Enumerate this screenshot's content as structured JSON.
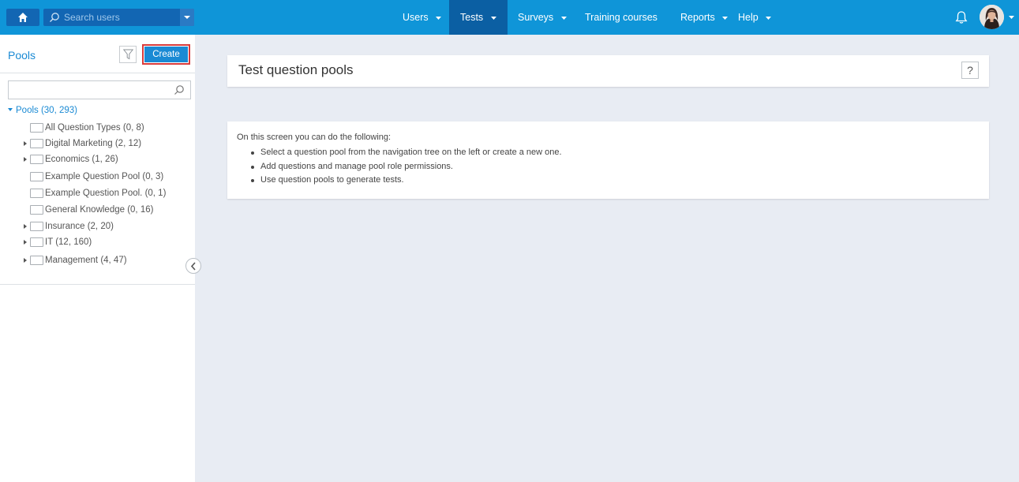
{
  "header": {
    "search": {
      "placeholder": "Search users",
      "value": ""
    },
    "nav": [
      {
        "label": "Users",
        "has_dropdown": true
      },
      {
        "label": "Tests",
        "has_dropdown": true,
        "active": true
      },
      {
        "label": "Surveys",
        "has_dropdown": true
      },
      {
        "label": "Training courses",
        "has_dropdown": false
      },
      {
        "label": "Reports",
        "has_dropdown": true
      },
      {
        "label": "Help",
        "has_dropdown": true
      }
    ]
  },
  "sidebar": {
    "title": "Pools",
    "create_label": "Create",
    "tree_search": {
      "placeholder": "",
      "value": ""
    },
    "root": {
      "label": "Pools (30, 293)"
    },
    "items": [
      {
        "label": "All Question Types (0, 8)",
        "expandable": false
      },
      {
        "label": "Digital Marketing (2, 12)",
        "expandable": true
      },
      {
        "label": "Economics (1, 26)",
        "expandable": true
      },
      {
        "label": "Example Question Pool (0, 3)",
        "expandable": false
      },
      {
        "label": "Example Question Pool. (0, 1)",
        "expandable": false
      },
      {
        "label": "General Knowledge (0, 16)",
        "expandable": false
      },
      {
        "label": "Insurance (2, 20)",
        "expandable": true
      },
      {
        "label": "IT (12, 160)",
        "expandable": true
      },
      {
        "label": "Management (4, 47)",
        "expandable": true
      }
    ]
  },
  "main": {
    "title": "Test question pools",
    "help_label": "?",
    "intro": "On this screen you can do the following:",
    "bullets": [
      "Select a question pool from the navigation tree on the left or create a new one.",
      "Add questions and manage pool role permissions.",
      "Use question pools to generate tests."
    ]
  },
  "colors": {
    "topbar": "#0f95d8",
    "active_nav": "#0b5fa3",
    "accent": "#1a8ad4",
    "create_border": "#d93b3b",
    "background": "#e8ecf3"
  }
}
